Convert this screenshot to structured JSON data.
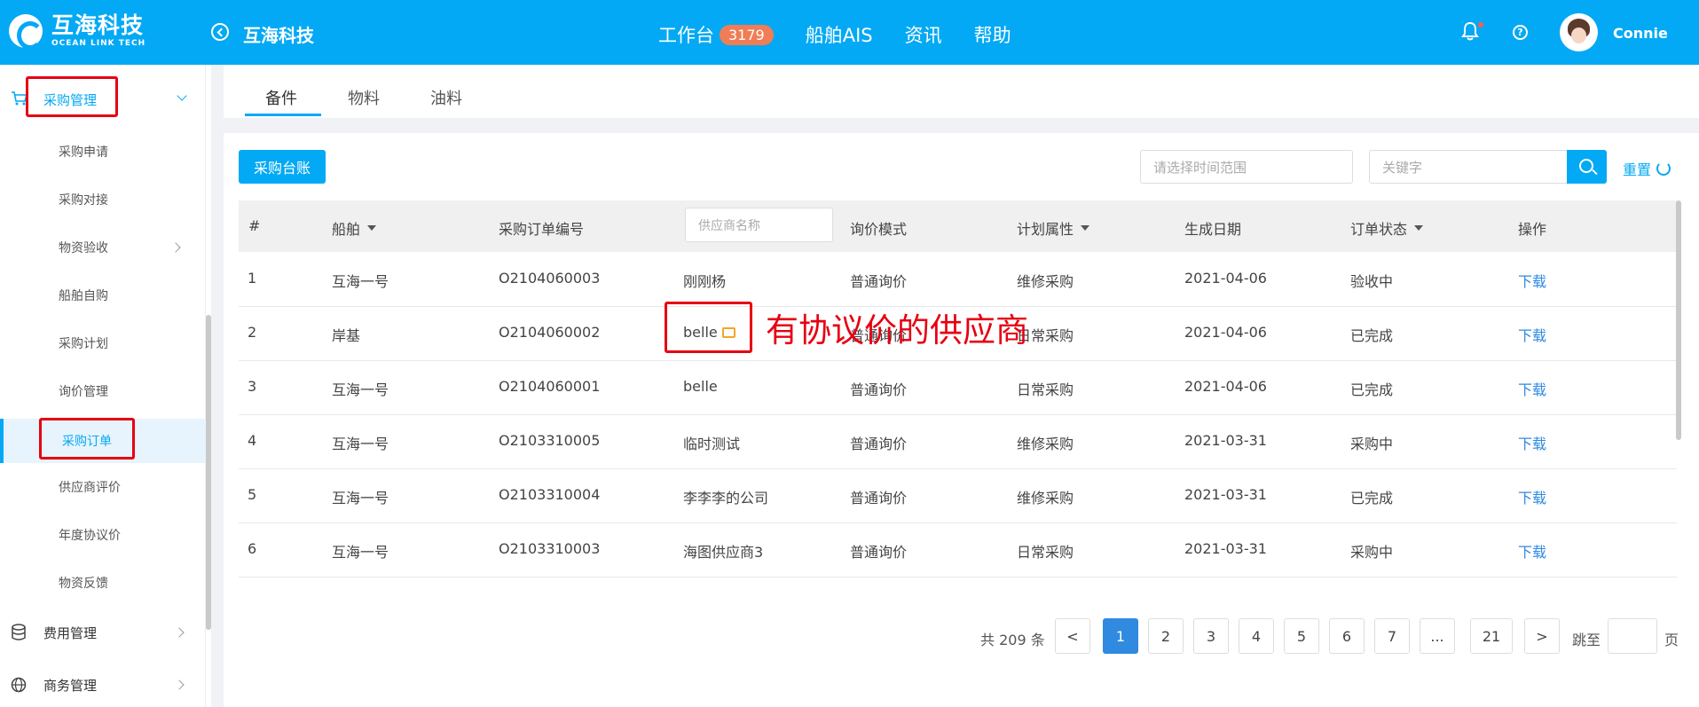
{
  "header": {
    "logo_cn": "互海科技",
    "logo_en": "OCEAN LINK TECH",
    "brand_title": "互海科技",
    "nav": [
      {
        "label": "工作台",
        "badge": "3179"
      },
      {
        "label": "船舶AIS"
      },
      {
        "label": "资讯"
      },
      {
        "label": "帮助"
      }
    ],
    "help_glyph": "?",
    "username": "Connie",
    "accent_color": "#03a9f4"
  },
  "sidebar": {
    "group_purchase": "采购管理",
    "items": [
      "采购申请",
      "采购对接",
      "物资验收",
      "船舶自购",
      "采购计划",
      "询价管理",
      "采购订单",
      "供应商评价",
      "年度协议价",
      "物资反馈"
    ],
    "active_item": "采购订单",
    "group_expense": "费用管理",
    "group_business": "商务管理"
  },
  "tabs": [
    "备件",
    "物料",
    "油料"
  ],
  "toolbar": {
    "ledger_button": "采购台账",
    "date_placeholder": "请选择时间范围",
    "keyword_placeholder": "关键字",
    "reset_label": "重置"
  },
  "table": {
    "headers": [
      "#",
      "船舶",
      "采购订单编号",
      "询价模式",
      "计划属性",
      "生成日期",
      "订单状态",
      "操作"
    ],
    "supplier_filter_placeholder": "供应商名称",
    "rows": [
      {
        "no": "1",
        "vessel": "互海一号",
        "order_no": "O2104060003",
        "supplier": "刚刚杨",
        "mode": "普通询价",
        "plan": "维修采购",
        "date": "2021-04-06",
        "status": "验收中",
        "action": "下载"
      },
      {
        "no": "2",
        "vessel": "岸基",
        "order_no": "O2104060002",
        "supplier": "belle",
        "mode": "普通询价",
        "plan": "日常采购",
        "date": "2021-04-06",
        "status": "已完成",
        "action": "下载"
      },
      {
        "no": "3",
        "vessel": "互海一号",
        "order_no": "O2104060001",
        "supplier": "belle",
        "mode": "普通询价",
        "plan": "日常采购",
        "date": "2021-04-06",
        "status": "已完成",
        "action": "下载"
      },
      {
        "no": "4",
        "vessel": "互海一号",
        "order_no": "O2103310005",
        "supplier": "临时测试",
        "mode": "普通询价",
        "plan": "维修采购",
        "date": "2021-03-31",
        "status": "采购中",
        "action": "下载"
      },
      {
        "no": "5",
        "vessel": "互海一号",
        "order_no": "O2103310004",
        "supplier": "李李李的公司",
        "mode": "普通询价",
        "plan": "维修采购",
        "date": "2021-03-31",
        "status": "已完成",
        "action": "下载"
      },
      {
        "no": "6",
        "vessel": "互海一号",
        "order_no": "O2103310003",
        "supplier": "海图供应商3",
        "mode": "普通询价",
        "plan": "日常采购",
        "date": "2021-03-31",
        "status": "采购中",
        "action": "下载"
      }
    ]
  },
  "annotation": "有协议价的供应商",
  "pagination": {
    "total": "共 209 条",
    "prev": "<",
    "pages": [
      "1",
      "2",
      "3",
      "4",
      "5",
      "6",
      "7",
      "...",
      "21"
    ],
    "current": "1",
    "next": ">",
    "jump_label": "跳至",
    "page_suffix": "页"
  }
}
